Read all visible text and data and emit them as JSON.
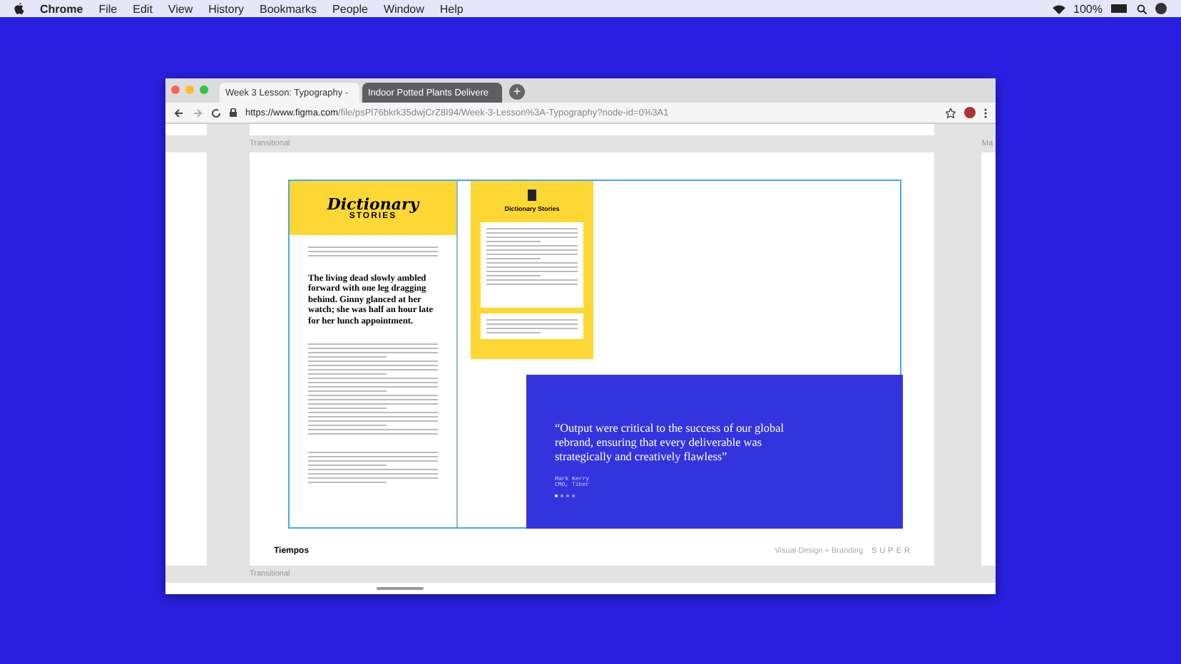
{
  "menubar": {
    "app": "Chrome",
    "menus": [
      "File",
      "Edit",
      "View",
      "History",
      "Bookmarks",
      "People",
      "Window",
      "Help"
    ],
    "battery": "100%"
  },
  "browser": {
    "tabs": [
      {
        "title": "Week 3 Lesson: Typography -",
        "selected": true
      },
      {
        "title": "Indoor Potted Plants Delivere",
        "selected": false
      }
    ],
    "new_tab_symbol": "+",
    "url_host": "https://www.figma.com",
    "url_path": "/file/psPl76bkrk35dwjCrZ8I94/Week-3-Lesson%3A-Typography?node-id=0%3A1"
  },
  "canvas": {
    "top_label": "Transitional",
    "edge_label": "Ma",
    "bottom_label": "Transitional",
    "article": {
      "title": "Dictionary",
      "subtitle": "STORIES",
      "headline": "The living dead slowly ambled forward with one leg dragging behind. Ginny glanced at her watch; she was half an hour late for her lunch appointment."
    },
    "mobile": {
      "title": "Dictionary Stories"
    },
    "quote": {
      "text": "“Output were critical to the success of our global rebrand, ensuring that every deliverable was strategically and creatively flawless”",
      "author": "Mark Kerry",
      "role": "CMO, Tiber",
      "dots": [
        {
          "selected": true
        },
        {
          "selected": false
        },
        {
          "selected": false
        },
        {
          "selected": false
        }
      ]
    },
    "footer": {
      "font_name": "Tiempos",
      "tagline": "Visual Design + Branding",
      "logo": "SUPER"
    }
  }
}
